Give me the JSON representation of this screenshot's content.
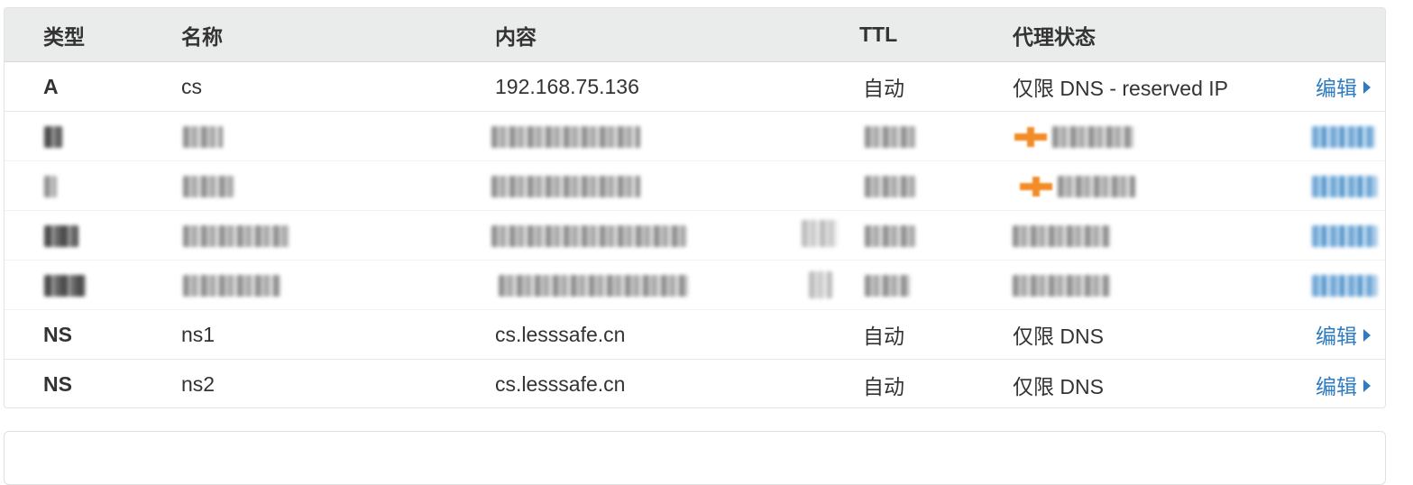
{
  "table": {
    "headers": {
      "type": "类型",
      "name": "名称",
      "content": "内容",
      "ttl": "TTL",
      "proxy": "代理状态"
    },
    "rows": [
      {
        "type": "A",
        "name": "cs",
        "content": "192.168.75.136",
        "ttl": "自动",
        "proxy": "仅限 DNS - reserved IP",
        "edit": "编辑"
      },
      {
        "type": "NS",
        "name": "ns1",
        "content": "cs.lesssafe.cn",
        "ttl": "自动",
        "proxy": "仅限 DNS",
        "edit": "编辑"
      },
      {
        "type": "NS",
        "name": "ns2",
        "content": "cs.lesssafe.cn",
        "ttl": "自动",
        "proxy": "仅限 DNS",
        "edit": "编辑"
      }
    ]
  },
  "colors": {
    "header_bg": "#eaebeb",
    "link": "#2f7bbf",
    "proxied_orange": "#f28c28"
  },
  "icons": {
    "edit_caret": "caret-right-icon",
    "proxied_cloud": "orange-cloud-icon"
  }
}
